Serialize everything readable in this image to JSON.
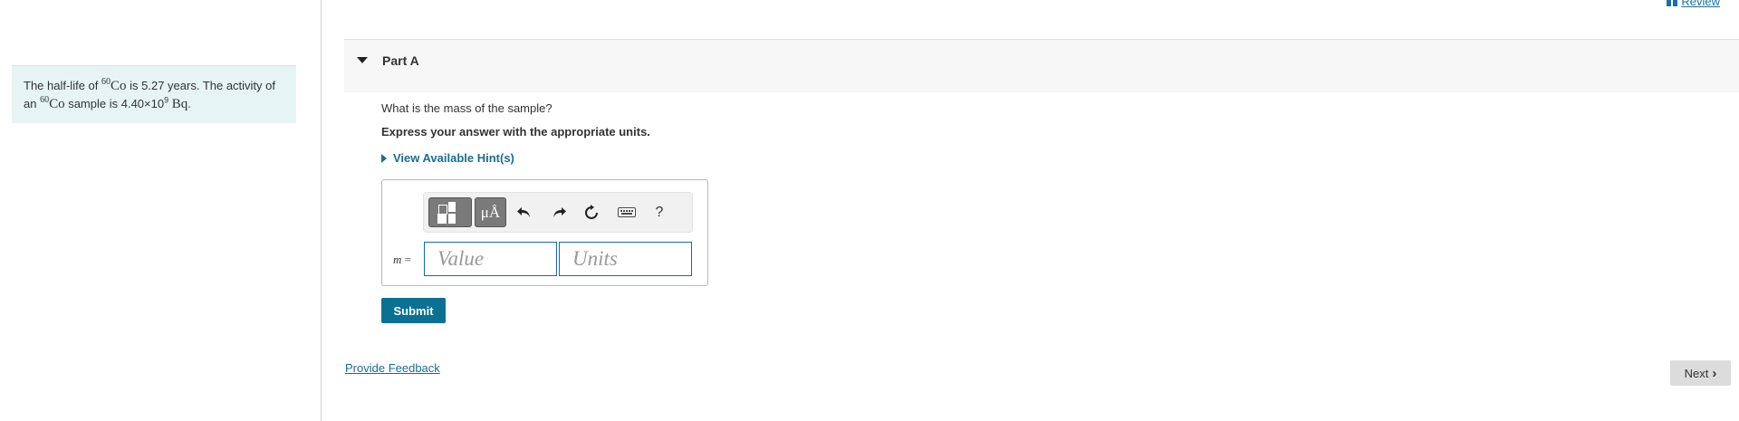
{
  "header": {
    "review_label": "Review"
  },
  "intro": {
    "t1": "The half-life of ",
    "iso_mass": "60",
    "iso_symbol": "Co",
    "t2": " is 5.27 years. The activity of an ",
    "iso2_mass": "60",
    "iso2_symbol": "Co",
    "t3": " sample is 4.40×10",
    "exp": "9",
    "t4": " ",
    "unit": "Bq",
    "t5": "."
  },
  "part": {
    "title": "Part A"
  },
  "question": {
    "text": "What is the mass of the sample?",
    "instruction": "Express your answer with the appropriate units.",
    "hint_label": "View Available Hint(s)"
  },
  "toolbar": {
    "templates_icon": "templates-icon",
    "units_label": "μÅ",
    "undo_icon": "undo-icon",
    "redo_icon": "redo-icon",
    "reset_icon": "reset-icon",
    "keyboard_icon": "keyboard-icon",
    "help_label": "?"
  },
  "answer": {
    "variable": "m",
    "equals": "=",
    "value_placeholder": "Value",
    "units_placeholder": "Units"
  },
  "actions": {
    "submit_label": "Submit",
    "feedback_label": "Provide Feedback",
    "next_label": "Next"
  },
  "colors": {
    "accent": "#0c7092",
    "link": "#1b6d93",
    "intro_bg": "#e6f4f5",
    "part_header_bg": "#f7f7f7",
    "next_bg": "#dcdcdc"
  }
}
